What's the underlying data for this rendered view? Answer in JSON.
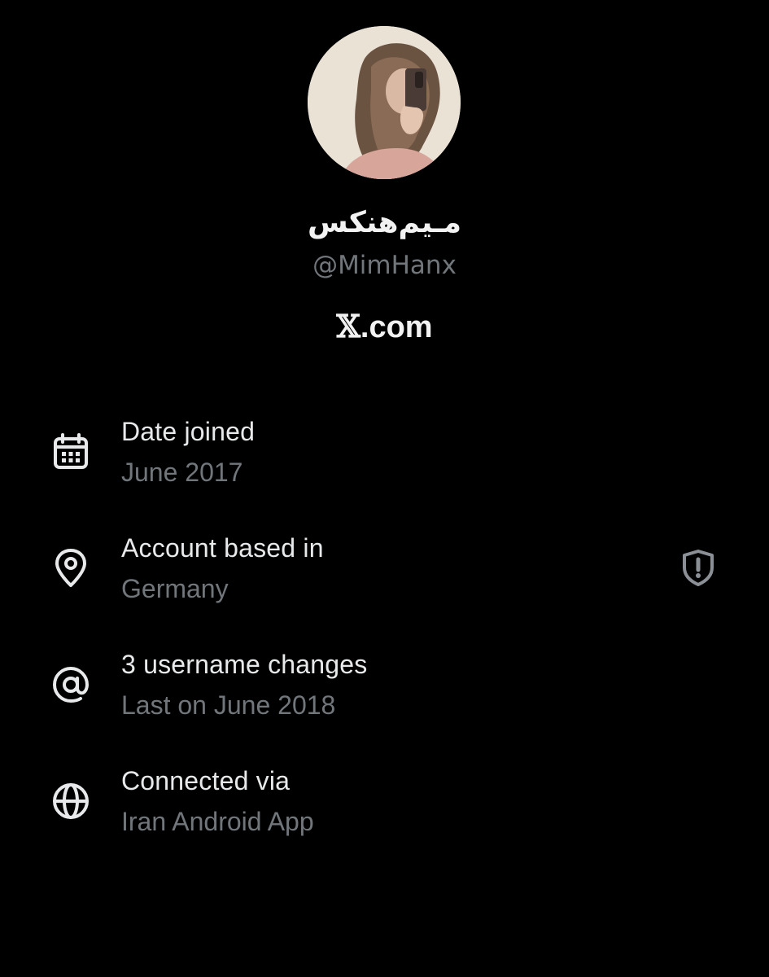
{
  "profile": {
    "display_name": "مـیم‌هنکس",
    "handle": "@MimHanx",
    "site_glyph": "𝕏",
    "site_rest": ".com"
  },
  "info": {
    "date_joined": {
      "icon": "calendar-icon",
      "title": "Date joined",
      "value": "June 2017"
    },
    "account_based": {
      "icon": "location-pin-icon",
      "title": "Account based in",
      "value": "Germany",
      "badge_icon": "shield-alert-icon"
    },
    "username_changes": {
      "icon": "at-sign-icon",
      "title": "3 username changes",
      "value": "Last on June 2018"
    },
    "connected_via": {
      "icon": "globe-icon",
      "title": "Connected via",
      "value": "Iran Android App"
    }
  },
  "colors": {
    "background": "#000000",
    "primary_text": "#e7e9ea",
    "secondary_text": "#71767b"
  }
}
